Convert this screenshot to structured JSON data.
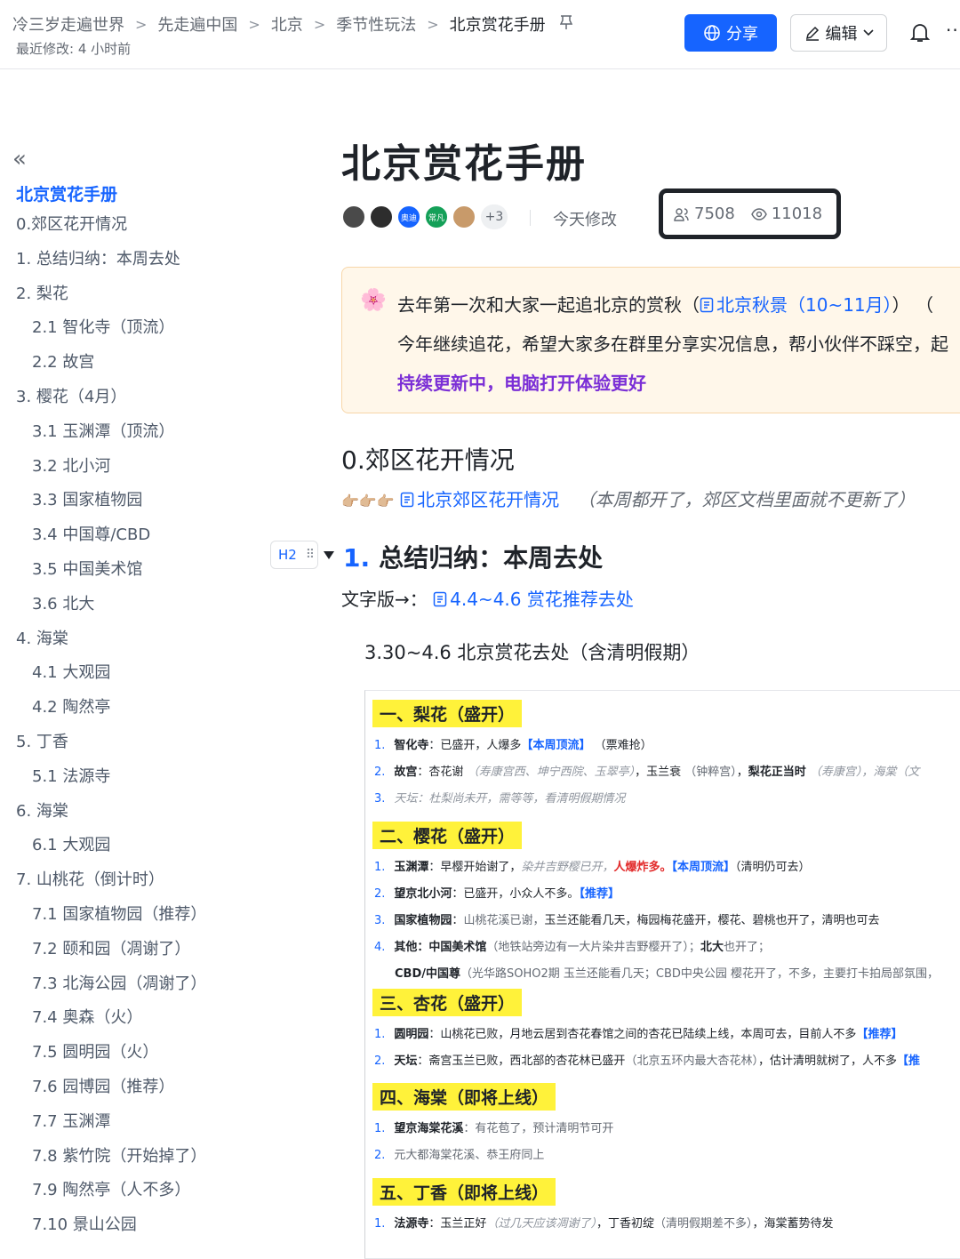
{
  "breadcrumb": [
    "冷三岁走遍世界",
    "先走遍中国",
    "北京",
    "季节性玩法",
    "北京赏花手册"
  ],
  "last_modified": "最近修改: 4 小时前",
  "toolbar": {
    "share_label": "分享",
    "edit_label": "编辑"
  },
  "toc": {
    "title": "北京赏花手册",
    "items": [
      {
        "label": "0.郊区花开情况",
        "level": 1
      },
      {
        "label": "1. 总结归纳：本周去处",
        "level": 1
      },
      {
        "label": "2. 梨花",
        "level": 1
      },
      {
        "label": "2.1 智化寺（顶流）",
        "level": 2
      },
      {
        "label": "2.2 故宫",
        "level": 2
      },
      {
        "label": "3. 樱花（4月）",
        "level": 1
      },
      {
        "label": "3.1 玉渊潭（顶流）",
        "level": 2
      },
      {
        "label": "3.2 北小河",
        "level": 2
      },
      {
        "label": "3.3 国家植物园",
        "level": 2
      },
      {
        "label": "3.4 中国尊/CBD",
        "level": 2
      },
      {
        "label": "3.5 中国美术馆",
        "level": 2
      },
      {
        "label": "3.6 北大",
        "level": 2
      },
      {
        "label": "4. 海棠",
        "level": 1
      },
      {
        "label": "4.1 大观园",
        "level": 2
      },
      {
        "label": "4.2 陶然亭",
        "level": 2
      },
      {
        "label": "5. 丁香",
        "level": 1
      },
      {
        "label": "5.1 法源寺",
        "level": 2
      },
      {
        "label": "6. 海棠",
        "level": 1
      },
      {
        "label": "6.1 大观园",
        "level": 2
      },
      {
        "label": "7. 山桃花（倒计时）",
        "level": 1
      },
      {
        "label": "7.1 国家植物园（推荐）",
        "level": 2
      },
      {
        "label": "7.2 颐和园（凋谢了）",
        "level": 2
      },
      {
        "label": "7.3 北海公园（凋谢了）",
        "level": 2
      },
      {
        "label": "7.4 奥森（火）",
        "level": 2
      },
      {
        "label": "7.5 圆明园（火）",
        "level": 2
      },
      {
        "label": "7.6 园博园（推荐）",
        "level": 2
      },
      {
        "label": "7.7 玉渊潭",
        "level": 2
      },
      {
        "label": "7.8 紫竹院（开始掉了）",
        "level": 2
      },
      {
        "label": "7.9 陶然亭（人不多）",
        "level": 2
      },
      {
        "label": "7.10 景山公园",
        "level": 2
      }
    ]
  },
  "doc": {
    "title": "北京赏花手册",
    "avatar_badges": [
      "奥迪",
      "常凡"
    ],
    "more_collaborators": "+3",
    "edited": "今天修改",
    "readers": "7508",
    "views": "11018",
    "callout": {
      "line1_pre": "去年第一次和大家一起追北京的赏秋（",
      "line1_link": "北京秋景（10~11月）",
      "line1_post": "）  （",
      "line2": "今年继续追花，希望大家多在群里分享实况信息，帮小伙伴不踩空，起",
      "line3": "持续更新中，电脑打开体验更好"
    },
    "section0": {
      "heading": "0.郊区花开情况",
      "link": "北京郊区花开情况",
      "note": "（本周都开了，郊区文档里面就不更新了）"
    },
    "section1": {
      "tag": "H2",
      "number": "1.",
      "heading": "总结归纳：本周去处",
      "text_prefix": "文字版→：",
      "text_link": "4.4~4.6 赏花推荐去处",
      "subtitle": "3.30~4.6 北京赏花去处（含清明假期）"
    }
  },
  "image": {
    "blocks": [
      {
        "title": "一、梨花（盛开）",
        "items": [
          {
            "n": "1.",
            "segs": [
              [
                "b",
                "智化寺"
              ],
              [
                "t",
                "：已盛开，人爆多"
              ],
              [
                "blue",
                "【本周顶流】"
              ],
              [
                "t",
                " （票难抢）"
              ]
            ]
          },
          {
            "n": "2.",
            "segs": [
              [
                "b",
                "故宫"
              ],
              [
                "t",
                "：杏花谢 "
              ],
              [
                "g",
                "（寿康宫西、坤宁西院、玉翠亭）"
              ],
              [
                "t",
                "，玉兰衰 "
              ],
              [
                "gr",
                "（钟粹宫）"
              ],
              [
                "t",
                "，"
              ],
              [
                "b",
                "梨花正当时"
              ],
              [
                "g",
                " （寿康宫），海棠（文"
              ]
            ]
          },
          {
            "n": "3.",
            "segs": [
              [
                "g",
                "天坛：杜梨尚未开，需等等，看清明假期情况"
              ]
            ]
          }
        ]
      },
      {
        "title": "二、樱花（盛开）",
        "items": [
          {
            "n": "1.",
            "segs": [
              [
                "b",
                "玉渊潭"
              ],
              [
                "t",
                "：早樱开始谢了，"
              ],
              [
                "g",
                "染井吉野樱已开，"
              ],
              [
                "red",
                "人爆炸多。"
              ],
              [
                "blue",
                "【本周顶流】"
              ],
              [
                "t",
                "（清明仍可去）"
              ]
            ]
          },
          {
            "n": "2.",
            "segs": [
              [
                "b",
                "望京北小河"
              ],
              [
                "t",
                "：已盛开，小众人不多。"
              ],
              [
                "blue",
                "【推荐】"
              ]
            ]
          },
          {
            "n": "3.",
            "segs": [
              [
                "b",
                "国家植物园"
              ],
              [
                "t",
                "："
              ],
              [
                "gr",
                "山桃花溪已谢，"
              ],
              [
                "t",
                "玉兰还能看几天，梅园梅花盛开，樱花、碧桃也开了，清明也可去"
              ]
            ]
          },
          {
            "n": "4.",
            "segs": [
              [
                "b",
                "其他：中国美术馆"
              ],
              [
                "gr",
                "（地铁站旁边有一大片染井吉野樱开了）；"
              ],
              [
                "b",
                "北大"
              ],
              [
                "gr",
                "也开了；"
              ]
            ]
          },
          {
            "n": "",
            "segs": [
              [
                "b",
                "CBD/中国尊"
              ],
              [
                "gr",
                "（光华路SOHO2期 玉兰还能看几天；CBD中央公园 樱花开了，不多，主要打卡拍局部氛围，"
              ]
            ]
          }
        ]
      },
      {
        "title": "三、杏花（盛开）",
        "items": [
          {
            "n": "1.",
            "segs": [
              [
                "b",
                "圆明园"
              ],
              [
                "t",
                "：山桃花已败，月地云居到杏花春馆之间的杏花已陆续上线，本周可去，目前人不多"
              ],
              [
                "blue",
                "【推荐】"
              ]
            ]
          },
          {
            "n": "2.",
            "segs": [
              [
                "b",
                "天坛"
              ],
              [
                "t",
                "：斋宫玉兰已败，西北部的杏花林已盛开"
              ],
              [
                "gr",
                "（北京五环内最大杏花林）"
              ],
              [
                "t",
                "，估计清明就树了，人不多"
              ],
              [
                "blue",
                "【推"
              ]
            ]
          }
        ]
      },
      {
        "title": "四、海棠（即将上线）",
        "items": [
          {
            "n": "1.",
            "segs": [
              [
                "b",
                "望京海棠花溪"
              ],
              [
                "gr",
                "：有花苞了，预计清明节可开"
              ]
            ]
          },
          {
            "n": "2.",
            "segs": [
              [
                "gr",
                "元大都海棠花溪、恭王府同上"
              ]
            ]
          }
        ]
      },
      {
        "title": "五、丁香（即将上线）",
        "items": [
          {
            "n": "1.",
            "segs": [
              [
                "b",
                "法源寺"
              ],
              [
                "t",
                "：玉兰正好"
              ],
              [
                "g",
                "（过几天应该凋谢了）"
              ],
              [
                "t",
                "，丁香初绽"
              ],
              [
                "gr",
                "（清明假期差不多）"
              ],
              [
                "t",
                "，海棠蓄势待发"
              ]
            ]
          }
        ]
      }
    ]
  },
  "colors": {
    "accent": "#1664ff",
    "highlight": "#fff23a",
    "callout_bg": "#fff7ea",
    "purple": "#7b2fd6"
  }
}
